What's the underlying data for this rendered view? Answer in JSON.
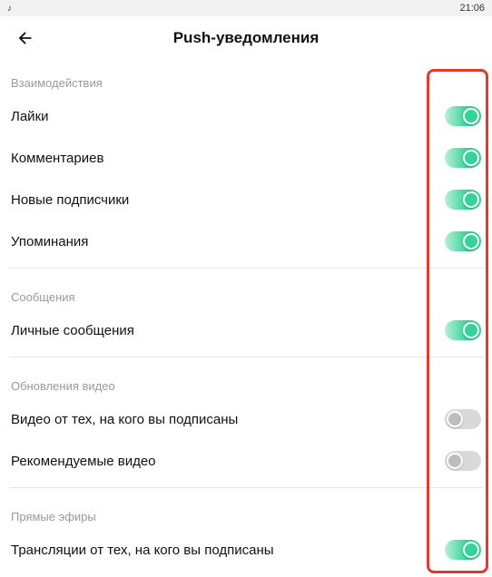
{
  "status": {
    "time": "21:06"
  },
  "header": {
    "title": "Push-уведомления"
  },
  "sections": [
    {
      "title": "Взаимодействия",
      "items": [
        {
          "label": "Лайки",
          "on": true,
          "name": "toggle-likes"
        },
        {
          "label": "Комментариев",
          "on": true,
          "name": "toggle-comments"
        },
        {
          "label": "Новые подписчики",
          "on": true,
          "name": "toggle-new-followers"
        },
        {
          "label": "Упоминания",
          "on": true,
          "name": "toggle-mentions"
        }
      ]
    },
    {
      "title": "Сообщения",
      "items": [
        {
          "label": "Личные сообщения",
          "on": true,
          "name": "toggle-direct-messages"
        }
      ]
    },
    {
      "title": "Обновления видео",
      "items": [
        {
          "label": "Видео от тех, на кого вы подписаны",
          "on": false,
          "name": "toggle-videos-from-following"
        },
        {
          "label": "Рекомендуемые видео",
          "on": false,
          "name": "toggle-recommended-videos"
        }
      ]
    },
    {
      "title": "Прямые эфиры",
      "items": [
        {
          "label": "Трансляции от тех, на кого вы подписаны",
          "on": true,
          "name": "toggle-live-from-following"
        }
      ]
    }
  ]
}
